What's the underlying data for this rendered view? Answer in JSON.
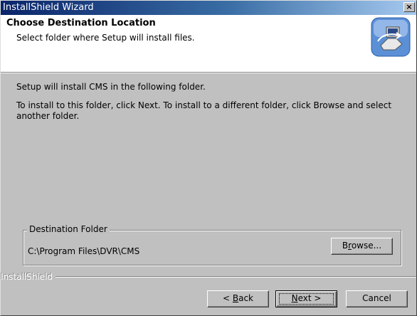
{
  "window": {
    "title": "InstallShield Wizard",
    "close_glyph": "×"
  },
  "header": {
    "title": "Choose Destination Location",
    "subtitle": "Select folder where Setup will install files.",
    "icon": "installer-computer-icon"
  },
  "body": {
    "line1": "Setup will install CMS in the following folder.",
    "line2": "To install to this folder, click Next. To install to a different folder, click Browse and select another folder."
  },
  "destination": {
    "group_label": "Destination Folder",
    "path": "C:\\Program Files\\DVR\\CMS",
    "browse_pre": "B",
    "browse_mnemonic": "r",
    "browse_post": "owse..."
  },
  "footer": {
    "brand": "InstallShield",
    "back_pre": "< ",
    "back_mnemonic": "B",
    "back_post": "ack",
    "next_mnemonic": "N",
    "next_post": "ext >",
    "cancel_label": "Cancel"
  },
  "colors": {
    "titlebar_start": "#0a246a",
    "titlebar_end": "#a6caf0",
    "face": "#c0c0c0"
  }
}
